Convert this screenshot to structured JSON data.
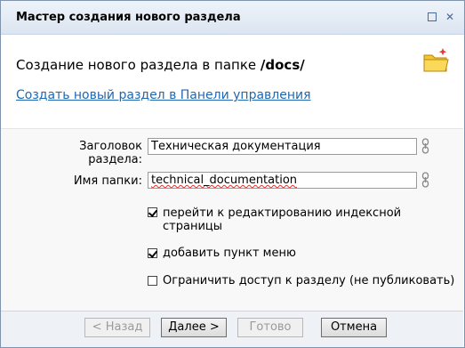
{
  "window": {
    "title": "Мастер создания нового раздела"
  },
  "heading": {
    "prefix": "Создание нового раздела в папке",
    "folder": "/docs/"
  },
  "link": {
    "label": "Создать новый раздел в Панели управления"
  },
  "form": {
    "section_title_label": "Заголовок раздела:",
    "section_title_value": "Техническая документация",
    "folder_label": "Имя папки:",
    "folder_value": "technical_documentation"
  },
  "options": [
    {
      "label": "перейти к редактированию индексной страницы",
      "checked": true
    },
    {
      "label": "добавить пункт меню",
      "checked": true
    },
    {
      "label": "Ограничить доступ к разделу (не публиковать)",
      "checked": false
    }
  ],
  "buttons": {
    "back": "< Назад",
    "next": "Далее >",
    "done": "Готово",
    "cancel": "Отмена"
  },
  "icons": {
    "header_icon": "folder-new-icon",
    "field_icon": "chain-link-icon"
  },
  "colors": {
    "link": "#1f67b4",
    "titlebar": "#dbe5f1"
  }
}
